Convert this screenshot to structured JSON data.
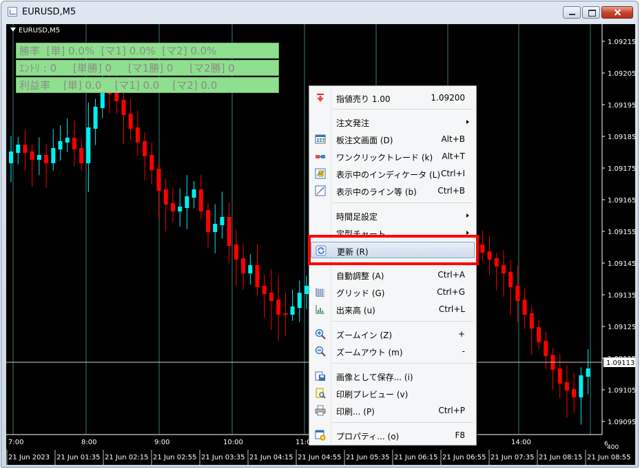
{
  "window": {
    "title": "EURUSD,M5"
  },
  "chart": {
    "symbol_label": "EURUSD,M5",
    "colors": {
      "background": "#000000",
      "bull": "#00f0f0",
      "bear": "#ff0000",
      "grid": "#3a7a7a",
      "axis_text": "#ffffff"
    },
    "price_labels": [
      "1.09215",
      "1.09205",
      "1.09195",
      "1.09185",
      "1.09175",
      "1.09165",
      "1.09155",
      "1.09145",
      "1.09135",
      "1.09125",
      "1.09115",
      "1.09105",
      "1.09095"
    ],
    "current_price": "1.09113",
    "axis_fragment": "6",
    "axis_fragment_2": "400",
    "top_time_labels": [
      "7:00",
      "8:00",
      "9:00",
      "10:00",
      "11:00",
      "14:00"
    ],
    "bottom_time_labels": [
      "21 Jun 2023",
      "21 Jun 01:35",
      "21 Jun 02:15",
      "21 Jun 02:55",
      "21 Jun 03:35",
      "21 Jun 04:15",
      "21 Jun 04:55",
      "21 Jun 05:35",
      "21 Jun 06:15",
      "21 Jun 06:55",
      "21 Jun 07:35",
      "21 Jun 08:15",
      "21 Jun 08:55"
    ]
  },
  "stats": {
    "row1": "勝率  [単] 0.0%  [マ1] 0.0%  [マ2] 0.0%",
    "row2": "ｴﾝﾄﾘ : 0     [単勝] 0     [マ1勝] 0     [マ2勝] 0",
    "row3": "利益率    [単] 0.0    [マ1] 0.0    [マ2] 0.0"
  },
  "context_menu": {
    "items": [
      {
        "label": "指値売り 1.00",
        "shortcut": "1.09200",
        "icon": "sell-arrow-icon"
      },
      {
        "label": "注文発注",
        "shortcut": "",
        "icon": ""
      },
      {
        "label": "板注文画面 (D)",
        "shortcut": "Alt+B",
        "icon": "order-book-icon"
      },
      {
        "label": "ワンクリックトレード (k)",
        "shortcut": "Alt+T",
        "icon": "one-click-trade-icon"
      },
      {
        "label": "表示中のインディケータ (L)",
        "shortcut": "Ctrl+I",
        "icon": "indicators-icon"
      },
      {
        "label": "表示中のライン等 (b)",
        "shortcut": "Ctrl+B",
        "icon": "lines-icon"
      },
      {
        "label": "時間足設定",
        "shortcut": "",
        "icon": ""
      },
      {
        "label": "定型チャート",
        "shortcut": "",
        "icon": ""
      },
      {
        "label": "更新 (R)",
        "shortcut": "",
        "icon": "refresh-icon"
      },
      {
        "label": "自動調整 (A)",
        "shortcut": "Ctrl+A",
        "icon": ""
      },
      {
        "label": "グリッド (G)",
        "shortcut": "Ctrl+G",
        "icon": "grid-icon"
      },
      {
        "label": "出来高 (u)",
        "shortcut": "Ctrl+L",
        "icon": "volume-icon"
      },
      {
        "label": "ズームイン (Z)",
        "shortcut": "+",
        "icon": "zoom-in-icon"
      },
      {
        "label": "ズームアウト (m)",
        "shortcut": "-",
        "icon": "zoom-out-icon"
      },
      {
        "label": "画像として保存... (i)",
        "shortcut": "",
        "icon": "save-image-icon"
      },
      {
        "label": "印刷プレビュー (v)",
        "shortcut": "",
        "icon": "print-preview-icon"
      },
      {
        "label": "印刷... (P)",
        "shortcut": "Ctrl+P",
        "icon": "print-icon"
      },
      {
        "label": "プロパティ... (o)",
        "shortcut": "F8",
        "icon": "properties-icon"
      }
    ]
  }
}
